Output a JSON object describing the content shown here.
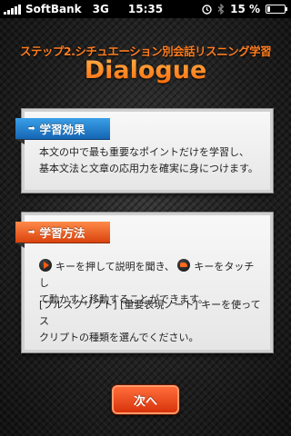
{
  "status_bar": {
    "carrier": "SoftBank",
    "network": "3G",
    "time": "15:35",
    "battery": "15 %",
    "battery_level": 0.15,
    "icons": [
      "signal-icon",
      "alarm-icon",
      "bluetooth-icon",
      "battery-icon"
    ]
  },
  "header": {
    "subtitle": "ステップ2.シチュエーション別会話リスニング学習",
    "title": "Dialogue"
  },
  "panel_effect": {
    "heading": "学習効果",
    "lines": [
      "本文の中で最も重要なポイントだけを学習し、",
      "基本文法と文章の応用力を確実に身につけます。"
    ]
  },
  "panel_method": {
    "heading": "学習方法",
    "text_a_part1": "キーを押して説明を聞き、",
    "text_a_part2": "キーをタッチし",
    "text_a_line2": "て動かすと移動することができます。",
    "text_b_line1": "[フルスクリプト] [重要表現ノート] キーを使ってス",
    "text_b_line2": "クリプトの種類を選んでください。"
  },
  "next_button": {
    "label": "次へ"
  },
  "colors": {
    "accent_orange": "#ff7d1f",
    "ribbon_blue": "#1b76c8",
    "ribbon_orange": "#e8561a",
    "button_red": "#e8451a"
  }
}
